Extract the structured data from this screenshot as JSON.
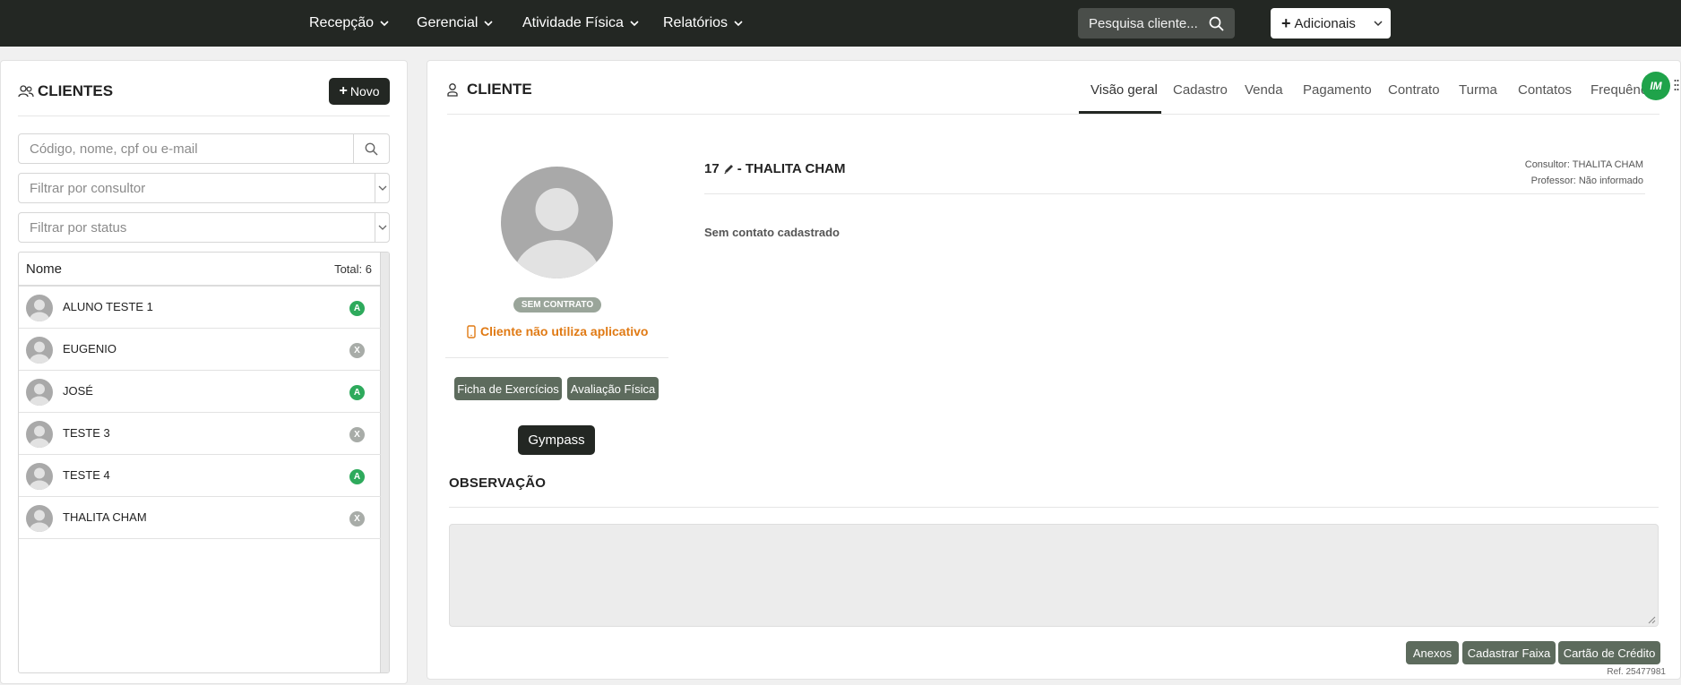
{
  "nav": {
    "items": [
      {
        "label": "Recepção"
      },
      {
        "label": "Gerencial"
      },
      {
        "label": "Atividade Física"
      },
      {
        "label": "Relatórios"
      }
    ],
    "search_placeholder": "Pesquisa cliente...",
    "add_label": "Adicionais"
  },
  "left": {
    "title": "CLIENTES",
    "new_label": "Novo",
    "search_placeholder": "Código, nome, cpf ou e-mail",
    "filter_consultor": "Filtrar por consultor",
    "filter_status": "Filtrar por status",
    "list_header": "Nome",
    "total_label": "Total: 6",
    "clients": [
      {
        "name": "ALUNO TESTE 1",
        "status": "A"
      },
      {
        "name": "EUGENIO",
        "status": "X"
      },
      {
        "name": "JOSÉ",
        "status": "A"
      },
      {
        "name": "TESTE 3",
        "status": "X"
      },
      {
        "name": "TESTE 4",
        "status": "A"
      },
      {
        "name": "THALITA CHAM",
        "status": "X"
      }
    ]
  },
  "right": {
    "title": "CLIENTE",
    "tabs": [
      {
        "label": "Visão geral",
        "active": true
      },
      {
        "label": "Cadastro"
      },
      {
        "label": "Venda"
      },
      {
        "label": "Pagamento"
      },
      {
        "label": "Contrato"
      },
      {
        "label": "Turma"
      },
      {
        "label": "Contatos"
      },
      {
        "label": "Frequênc"
      }
    ],
    "logo_text": "IM",
    "contract_badge": "SEM CONTRATO",
    "app_note": "Cliente não utiliza aplicativo",
    "btn_ficha": "Ficha de Exercícios",
    "btn_avaliacao": "Avaliação Física",
    "btn_gympass": "Gympass",
    "client_id": "17",
    "client_name": "- THALITA CHAM",
    "consultor": "Consultor: THALITA CHAM",
    "professor": "Professor: Não informado",
    "no_contact": "Sem contato cadastrado",
    "observacao_title": "OBSERVAÇÃO",
    "btn_anexos": "Anexos",
    "btn_faixa": "Cadastrar Faixa",
    "btn_cartao": "Cartão de Crédito",
    "ref": "Ref. 25477981"
  },
  "colors": {
    "navbar": "#232723",
    "status_active": "#2eaa5c",
    "status_inactive": "#a8aca8",
    "warning": "#e07a14",
    "button_green": "#5d6b5d"
  }
}
